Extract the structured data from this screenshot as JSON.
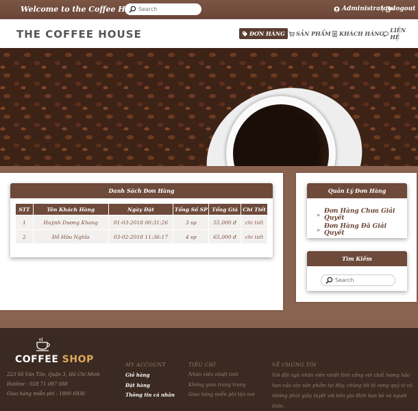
{
  "topbar": {
    "welcome": "Welcome to the Coffee House",
    "search_placeholder": "Search",
    "user": "Administrators",
    "separator": "|",
    "logout": "logout"
  },
  "header": {
    "logo": "THE COFFEE HOUSE",
    "nav": [
      {
        "label": "ĐƠN HÀNG",
        "icon": "tag-icon",
        "active": true
      },
      {
        "label": "SẢN PHẨM",
        "icon": "cart-icon",
        "active": false
      },
      {
        "label": "KHÁCH HÀNG",
        "icon": "user-card-icon",
        "active": false
      },
      {
        "label": "LIÊN HỆ",
        "icon": "comment-icon",
        "active": false
      }
    ]
  },
  "orders": {
    "title": "Danh Sách Đơn Hàng",
    "columns": [
      "STT",
      "Tên Khách Hàng",
      "Ngày Đặt",
      "Tổng Số SP",
      "Tổng Giá",
      "Chi Tiết"
    ],
    "rows": [
      [
        "1",
        "Huỳnh Dương Khang",
        "01-03-2018 00:31:26",
        "3 sp",
        "55,000 đ",
        "chi tiết"
      ],
      [
        "2",
        "Đỗ Hữu Nghĩa",
        "03-02-2018 11:36:17",
        "4 sp",
        "65,000 đ",
        "chi tiết"
      ]
    ]
  },
  "manage": {
    "title": "Quản Lý Đơn Hàng",
    "items": [
      "Đơn Hàng Chưa Giải Quyết",
      "Đơn Hàng Đã Giải Quyết"
    ]
  },
  "side_search": {
    "title": "Tìm Kiếm",
    "placeholder": "Search"
  },
  "footer": {
    "logo_main": "COFFEE",
    "logo_accent": " SHOP",
    "address": "223 Võ Văn Tần, Quận 3, Hồ Chí Minh",
    "hotline": "Hotline : 028 71 087 088",
    "delivery": "Giao hàng miễn phí : 1800 6936",
    "account": {
      "heading": "MY ACCOUNT",
      "links": [
        "Giỏ hàng",
        "Đặt hàng",
        "Thông tin cá nhân"
      ]
    },
    "criteria": {
      "heading": "TIÊU CHÍ",
      "items": [
        "Nhân viên nhiệt tình",
        "Không gian trang trọng",
        "Giao hàng miễn phí tận nơi"
      ]
    },
    "about": {
      "heading": "VỀ CHÚNG TÔI",
      "text": "Với đội ngũ nhân viên nhiệt tình cộng với chất lượng hảo hạn của các sản phẩm tại đây, chúng tôi hi vọng quý vị có những phút giây tuyệt vời bên gia đình bạn bè và người thân."
    }
  },
  "colors": {
    "brown_dark": "#6e4a3a",
    "background": "#8a6250",
    "footer": "#3a2a22",
    "accent": "#e0a75d"
  }
}
